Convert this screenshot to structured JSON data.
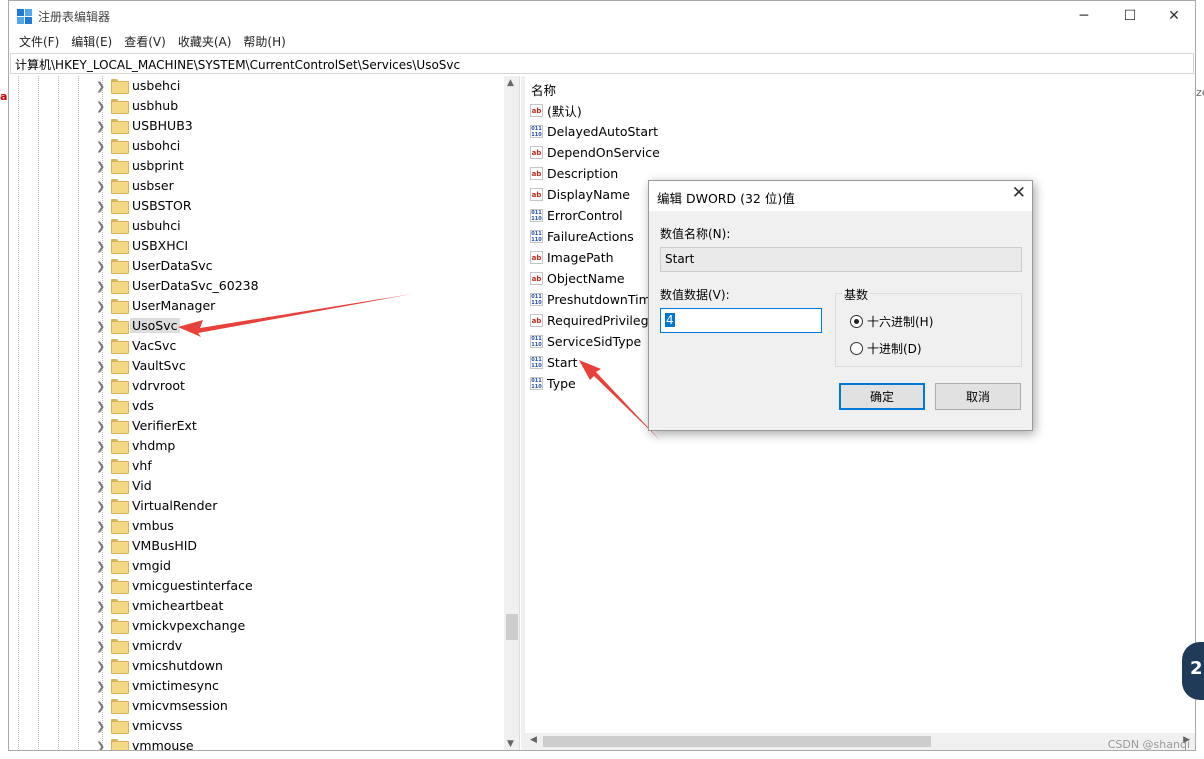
{
  "window": {
    "title": "注册表编辑器",
    "minimize_glyph": "─",
    "maximize_glyph": "☐",
    "close_glyph": "✕"
  },
  "menu": [
    "文件(F)",
    "编辑(E)",
    "查看(V)",
    "收藏夹(A)",
    "帮助(H)"
  ],
  "address_bar": "计算机\\HKEY_LOCAL_MACHINE\\SYSTEM\\CurrentControlSet\\Services\\UsoSvc",
  "tree": {
    "items": [
      {
        "label": "usbehci"
      },
      {
        "label": "usbhub"
      },
      {
        "label": "USBHUB3"
      },
      {
        "label": "usbohci"
      },
      {
        "label": "usbprint"
      },
      {
        "label": "usbser"
      },
      {
        "label": "USBSTOR"
      },
      {
        "label": "usbuhci"
      },
      {
        "label": "USBXHCI"
      },
      {
        "label": "UserDataSvc"
      },
      {
        "label": "UserDataSvc_60238"
      },
      {
        "label": "UserManager"
      },
      {
        "label": "UsoSvc",
        "selected": true
      },
      {
        "label": "VacSvc"
      },
      {
        "label": "VaultSvc"
      },
      {
        "label": "vdrvroot"
      },
      {
        "label": "vds"
      },
      {
        "label": "VerifierExt"
      },
      {
        "label": "vhdmp"
      },
      {
        "label": "vhf"
      },
      {
        "label": "Vid"
      },
      {
        "label": "VirtualRender"
      },
      {
        "label": "vmbus"
      },
      {
        "label": "VMBusHID"
      },
      {
        "label": "vmgid"
      },
      {
        "label": "vmicguestinterface"
      },
      {
        "label": "vmicheartbeat"
      },
      {
        "label": "vmickvpexchange"
      },
      {
        "label": "vmicrdv"
      },
      {
        "label": "vmicshutdown"
      },
      {
        "label": "vmictimesync"
      },
      {
        "label": "vmicvmsession"
      },
      {
        "label": "vmicvss"
      },
      {
        "label": "vmmouse"
      }
    ]
  },
  "values_pane": {
    "column_header": "名称",
    "values": [
      {
        "name": "(默认)",
        "type": "sz"
      },
      {
        "name": "DelayedAutoStart",
        "type": "dword"
      },
      {
        "name": "DependOnService",
        "type": "sz"
      },
      {
        "name": "Description",
        "type": "sz"
      },
      {
        "name": "DisplayName",
        "type": "sz"
      },
      {
        "name": "ErrorControl",
        "type": "dword"
      },
      {
        "name": "FailureActions",
        "type": "dword"
      },
      {
        "name": "ImagePath",
        "type": "sz"
      },
      {
        "name": "ObjectName",
        "type": "sz"
      },
      {
        "name": "PreshutdownTime",
        "type": "dword"
      },
      {
        "name": "RequiredPrivilege",
        "type": "sz"
      },
      {
        "name": "ServiceSidType",
        "type": "dword"
      },
      {
        "name": "Start",
        "type": "dword"
      },
      {
        "name": "Type",
        "type": "dword"
      }
    ],
    "icon_text": {
      "sz": "ab",
      "dword": "011\n110"
    }
  },
  "dialog": {
    "title": "编辑 DWORD (32 位)值",
    "close_glyph": "✕",
    "name_label": "数值名称(N):",
    "name_value": "Start",
    "data_label": "数值数据(V):",
    "data_value": "4",
    "base_label": "基数",
    "hex_label": "十六进制(H)",
    "dec_label": "十进制(D)",
    "hex_selected": true,
    "ok_label": "确定",
    "cancel_label": "取消"
  },
  "annotation_color": "#e8403a",
  "watermark": "CSDN @shanqi",
  "badge_text": "2",
  "edge_fragment": "ze",
  "left_fragment": "a"
}
